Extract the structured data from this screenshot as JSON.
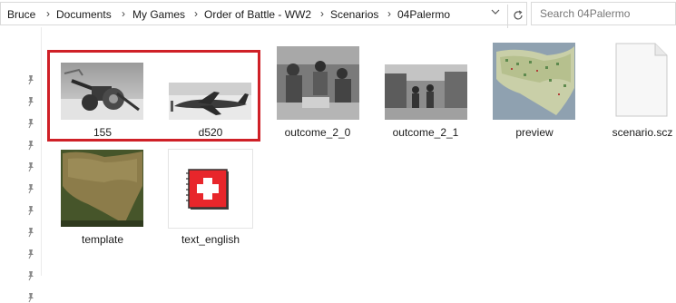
{
  "breadcrumb": {
    "items": [
      "Bruce",
      "Documents",
      "My Games",
      "Order of Battle - WW2",
      "Scenarios",
      "04Palermo"
    ],
    "separator": "›"
  },
  "search": {
    "placeholder": "Search 04Palermo"
  },
  "icons": {
    "dropdown": "chevron-down-icon",
    "refresh": "refresh-icon",
    "pin": "pin-icon"
  },
  "files": [
    {
      "name": "155",
      "kind": "image",
      "selected": true
    },
    {
      "name": "d520",
      "kind": "image",
      "selected": true
    },
    {
      "name": "outcome_2_0",
      "kind": "image",
      "selected": false
    },
    {
      "name": "outcome_2_1",
      "kind": "image",
      "selected": false
    },
    {
      "name": "preview",
      "kind": "image",
      "selected": false
    },
    {
      "name": "scenario.scz",
      "kind": "file",
      "selected": false
    },
    {
      "name": "template",
      "kind": "image",
      "selected": false
    },
    {
      "name": "text_english",
      "kind": "text-resource",
      "selected": false
    }
  ],
  "colors": {
    "selection": "#cf2027",
    "text_icon_bg": "#e8262b"
  }
}
